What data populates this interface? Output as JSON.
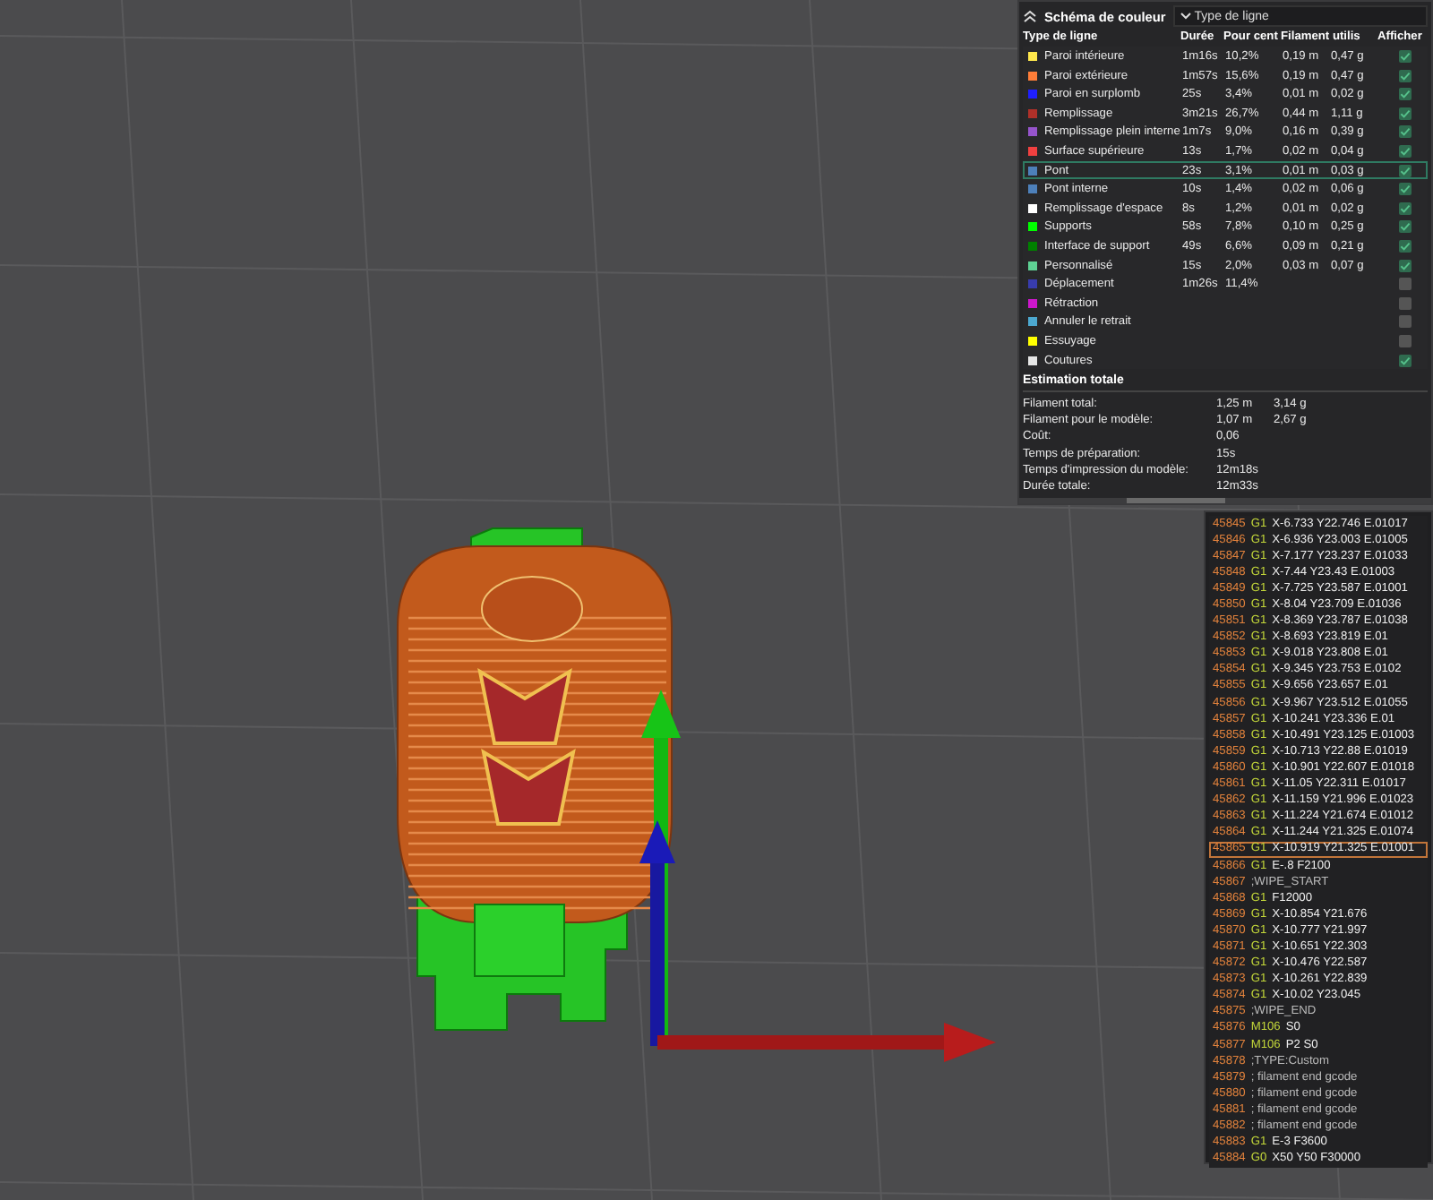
{
  "legend": {
    "title": "Schéma de couleur",
    "view_select": "Type de ligne",
    "columns": [
      "Type de ligne",
      "Durée",
      "Pour cent",
      "Filament utilis",
      "Afficher"
    ],
    "rows": [
      {
        "name": "Paroi intérieure",
        "color": "#ffe74c",
        "time": "1m16s",
        "percent": "10,2%",
        "length": "0,19 m",
        "weight": "0,47 g",
        "checked": true,
        "selected": false
      },
      {
        "name": "Paroi extérieure",
        "color": "#ff7d38",
        "time": "1m57s",
        "percent": "15,6%",
        "length": "0,19 m",
        "weight": "0,47 g",
        "checked": true,
        "selected": false
      },
      {
        "name": "Paroi en surplomb",
        "color": "#1f1fff",
        "time": "25s",
        "percent": "3,4%",
        "length": "0,01 m",
        "weight": "0,02 g",
        "checked": true,
        "selected": false
      },
      {
        "name": "Remplissage",
        "color": "#b03029",
        "time": "3m21s",
        "percent": "26,7%",
        "length": "0,44 m",
        "weight": "1,11 g",
        "checked": true,
        "selected": false
      },
      {
        "name": "Remplissage plein interne",
        "color": "#9654cc",
        "time": "1m7s",
        "percent": "9,0%",
        "length": "0,16 m",
        "weight": "0,39 g",
        "checked": true,
        "selected": false
      },
      {
        "name": "Surface supérieure",
        "color": "#f04040",
        "time": "13s",
        "percent": "1,7%",
        "length": "0,02 m",
        "weight": "0,04 g",
        "checked": true,
        "selected": false
      },
      {
        "name": "Pont",
        "color": "#4d80ba",
        "time": "23s",
        "percent": "3,1%",
        "length": "0,01 m",
        "weight": "0,03 g",
        "checked": true,
        "selected": true
      },
      {
        "name": "Pont interne",
        "color": "#4d80ba",
        "time": "10s",
        "percent": "1,4%",
        "length": "0,02 m",
        "weight": "0,06 g",
        "checked": true,
        "selected": false
      },
      {
        "name": "Remplissage d'espace",
        "color": "#ffffff",
        "time": "8s",
        "percent": "1,2%",
        "length": "0,01 m",
        "weight": "0,02 g",
        "checked": true,
        "selected": false
      },
      {
        "name": "Supports",
        "color": "#00ff00",
        "time": "58s",
        "percent": "7,8%",
        "length": "0,10 m",
        "weight": "0,25 g",
        "checked": true,
        "selected": false
      },
      {
        "name": "Interface de support",
        "color": "#008000",
        "time": "49s",
        "percent": "6,6%",
        "length": "0,09 m",
        "weight": "0,21 g",
        "checked": true,
        "selected": false
      },
      {
        "name": "Personnalisé",
        "color": "#5ed194",
        "time": "15s",
        "percent": "2,0%",
        "length": "0,03 m",
        "weight": "0,07 g",
        "checked": true,
        "selected": false
      },
      {
        "name": "Déplacement",
        "color": "#383cad",
        "time": "1m26s",
        "percent": "11,4%",
        "checked": false,
        "selected": false
      },
      {
        "name": "Rétraction",
        "color": "#cd17cd",
        "checked": false,
        "selected": false
      },
      {
        "name": "Annuler le retrait",
        "color": "#4ca8d0",
        "checked": false,
        "selected": false
      },
      {
        "name": "Essuyage",
        "color": "#ffff00",
        "checked": false,
        "selected": false
      },
      {
        "name": "Coutures",
        "color": "#e6e6e6",
        "checked": true,
        "selected": false
      }
    ],
    "summary_title": "Estimation totale",
    "summary": [
      {
        "label": "Filament total:",
        "value": "1,25 m",
        "value_2": "3,14 g"
      },
      {
        "label": "Filament pour le modèle:",
        "value": "1,07 m",
        "value_2": "2,67 g"
      },
      {
        "label": "Coût:",
        "value": "0,06"
      },
      {
        "label": "Temps de préparation:",
        "value": "15s"
      },
      {
        "label": "Temps d'impression du modèle:",
        "value": "12m18s"
      },
      {
        "label": "Durée totale:",
        "value": "12m33s"
      }
    ]
  },
  "gcode": {
    "lines": [
      {
        "number": "45845",
        "kind": "command",
        "command": "G1",
        "args": "X-6.733 Y22.746 E.01017",
        "selected": false
      },
      {
        "number": "45846",
        "kind": "command",
        "command": "G1",
        "args": "X-6.936 Y23.003 E.01005",
        "selected": false
      },
      {
        "number": "45847",
        "kind": "command",
        "command": "G1",
        "args": "X-7.177 Y23.237 E.01033",
        "selected": false
      },
      {
        "number": "45848",
        "kind": "command",
        "command": "G1",
        "args": "X-7.44 Y23.43 E.01003",
        "selected": false
      },
      {
        "number": "45849",
        "kind": "command",
        "command": "G1",
        "args": "X-7.725 Y23.587 E.01001",
        "selected": false
      },
      {
        "number": "45850",
        "kind": "command",
        "command": "G1",
        "args": "X-8.04 Y23.709 E.01036",
        "selected": false
      },
      {
        "number": "45851",
        "kind": "command",
        "command": "G1",
        "args": "X-8.369 Y23.787 E.01038",
        "selected": false
      },
      {
        "number": "45852",
        "kind": "command",
        "command": "G1",
        "args": "X-8.693 Y23.819 E.01",
        "selected": false
      },
      {
        "number": "45853",
        "kind": "command",
        "command": "G1",
        "args": "X-9.018 Y23.808 E.01",
        "selected": false
      },
      {
        "number": "45854",
        "kind": "command",
        "command": "G1",
        "args": "X-9.345 Y23.753 E.0102",
        "selected": false
      },
      {
        "number": "45855",
        "kind": "command",
        "command": "G1",
        "args": "X-9.656 Y23.657 E.01",
        "selected": false
      },
      {
        "number": "45856",
        "kind": "command",
        "command": "G1",
        "args": "X-9.967 Y23.512 E.01055",
        "selected": false
      },
      {
        "number": "45857",
        "kind": "command",
        "command": "G1",
        "args": "X-10.241 Y23.336 E.01",
        "selected": false
      },
      {
        "number": "45858",
        "kind": "command",
        "command": "G1",
        "args": "X-10.491 Y23.125 E.01003",
        "selected": false
      },
      {
        "number": "45859",
        "kind": "command",
        "command": "G1",
        "args": "X-10.713 Y22.88 E.01019",
        "selected": false
      },
      {
        "number": "45860",
        "kind": "command",
        "command": "G1",
        "args": "X-10.901 Y22.607 E.01018",
        "selected": false
      },
      {
        "number": "45861",
        "kind": "command",
        "command": "G1",
        "args": "X-11.05 Y22.311 E.01017",
        "selected": false
      },
      {
        "number": "45862",
        "kind": "command",
        "command": "G1",
        "args": "X-11.159 Y21.996 E.01023",
        "selected": false
      },
      {
        "number": "45863",
        "kind": "command",
        "command": "G1",
        "args": "X-11.224 Y21.674 E.01012",
        "selected": false
      },
      {
        "number": "45864",
        "kind": "command",
        "command": "G1",
        "args": "X-11.244 Y21.325 E.01074",
        "selected": false
      },
      {
        "number": "45865",
        "kind": "command",
        "command": "G1",
        "args": "X-10.919 Y21.325 E.01001",
        "selected": true
      },
      {
        "number": "45866",
        "kind": "command",
        "command": "G1",
        "args": "E-.8 F2100",
        "selected": false
      },
      {
        "number": "45867",
        "kind": "comment",
        "text": ";WIPE_START",
        "selected": false
      },
      {
        "number": "45868",
        "kind": "command",
        "command": "G1",
        "args": "F12000",
        "selected": false
      },
      {
        "number": "45869",
        "kind": "command",
        "command": "G1",
        "args": "X-10.854 Y21.676",
        "selected": false
      },
      {
        "number": "45870",
        "kind": "command",
        "command": "G1",
        "args": "X-10.777 Y21.997",
        "selected": false
      },
      {
        "number": "45871",
        "kind": "command",
        "command": "G1",
        "args": "X-10.651 Y22.303",
        "selected": false
      },
      {
        "number": "45872",
        "kind": "command",
        "command": "G1",
        "args": "X-10.476 Y22.587",
        "selected": false
      },
      {
        "number": "45873",
        "kind": "command",
        "command": "G1",
        "args": "X-10.261 Y22.839",
        "selected": false
      },
      {
        "number": "45874",
        "kind": "command",
        "command": "G1",
        "args": "X-10.02 Y23.045",
        "selected": false
      },
      {
        "number": "45875",
        "kind": "comment",
        "text": ";WIPE_END",
        "selected": false
      },
      {
        "number": "45876",
        "kind": "command",
        "command": "M106",
        "args": "S0",
        "selected": false
      },
      {
        "number": "45877",
        "kind": "command",
        "command": "M106",
        "args": "P2 S0",
        "selected": false
      },
      {
        "number": "45878",
        "kind": "comment",
        "text": ";TYPE:Custom",
        "selected": false
      },
      {
        "number": "45879",
        "kind": "comment",
        "text": "; filament end gcode",
        "selected": false
      },
      {
        "number": "45880",
        "kind": "comment",
        "text": "; filament end gcode",
        "selected": false
      },
      {
        "number": "45881",
        "kind": "comment",
        "text": "; filament end gcode",
        "selected": false
      },
      {
        "number": "45882",
        "kind": "comment",
        "text": "; filament end gcode",
        "selected": false
      },
      {
        "number": "45883",
        "kind": "command",
        "command": "G1",
        "args": "E-3 F3600",
        "selected": false
      },
      {
        "number": "45884",
        "kind": "command",
        "command": "G0",
        "args": "X50 Y50 F30000",
        "selected": false
      }
    ]
  }
}
